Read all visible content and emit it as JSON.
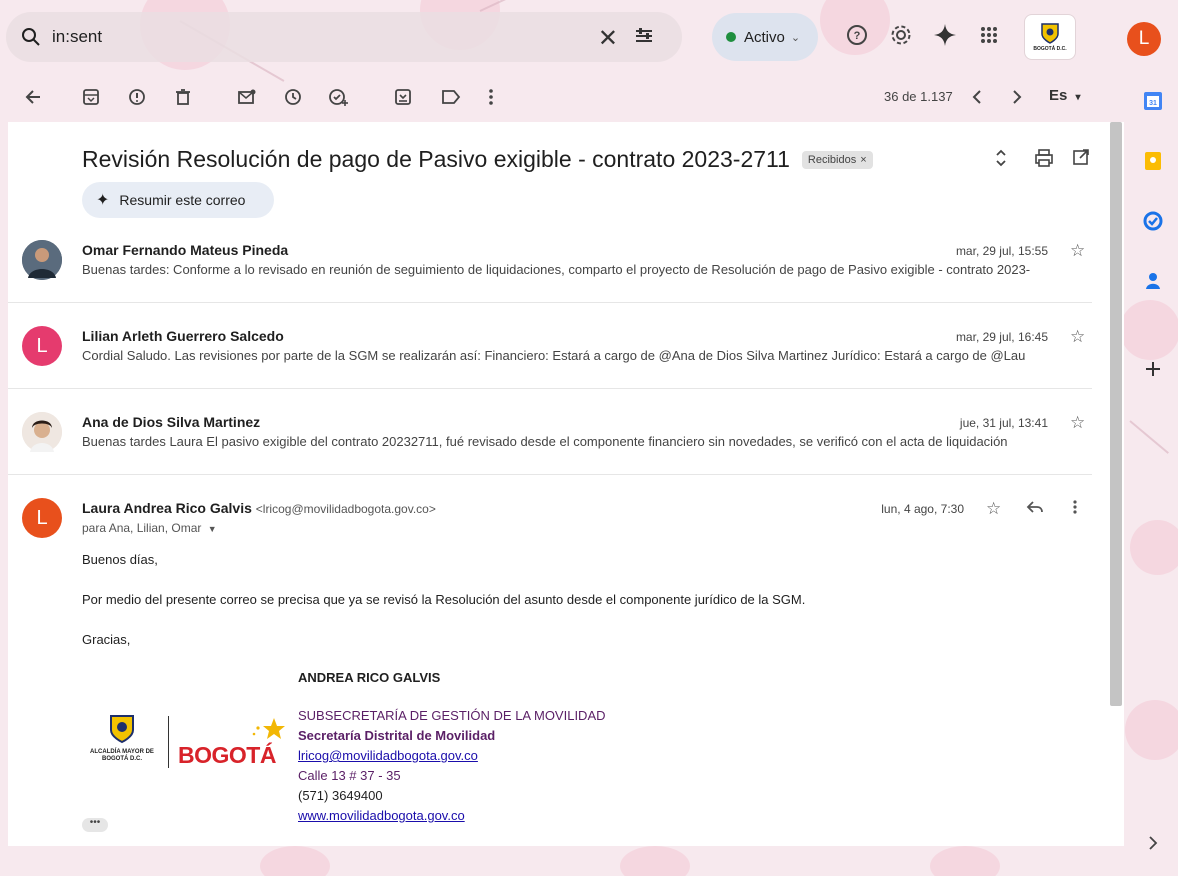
{
  "search": {
    "value": "in:sent"
  },
  "status": {
    "label": "Activo"
  },
  "org_logo": {
    "text": "BOGOTÁ D.C."
  },
  "user": {
    "initial": "L"
  },
  "toolbar": {
    "pager": "36 de 1.137",
    "lang": "Es"
  },
  "thread": {
    "subject": "Revisión Resolución de pago de Pasivo exigible - contrato 2023-2711",
    "label": "Recibidos",
    "label_close": "×",
    "summarize": "Resumir este correo"
  },
  "messages": [
    {
      "sender": "Omar Fernando Mateus Pineda",
      "date": "mar, 29 jul, 15:55",
      "snippet": "Buenas tardes: Conforme a lo revisado en reunión de seguimiento de liquidaciones, comparto el proyecto de Resolución de pago de Pasivo exigible - contrato 2023-",
      "avatar_color": "#3b4a5c"
    },
    {
      "sender": "Lilian Arleth Guerrero Salcedo",
      "date": "mar, 29 jul, 16:45",
      "snippet": "Cordial Saludo. Las revisiones por parte de la SGM se realizarán así: Financiero: Estará a cargo de @Ana de Dios Silva Martinez Jurídico: Estará a cargo de @Lau",
      "avatar_initial": "L",
      "avatar_color": "#e53b6e"
    },
    {
      "sender": "Ana de Dios Silva Martinez",
      "date": "jue, 31 jul, 13:41",
      "snippet": "Buenas tardes Laura El pasivo exigible del contrato 20232711, fué revisado desde el componente financiero sin novedades, se verificó con el acta de liquidación",
      "avatar_color": "#c9b6a8"
    }
  ],
  "expanded": {
    "sender": "Laura Andrea Rico Galvis",
    "email": "<lricog@movilidadbogota.gov.co>",
    "date": "lun, 4 ago, 7:30",
    "recipients": "para Ana, Lilian, Omar",
    "avatar_initial": "L",
    "avatar_color": "#e8501c",
    "greeting": "Buenos días,",
    "body": "Por medio del presente correo se precisa que ya se revisó la Resolución del asunto desde el componente jurídico de la SGM.",
    "closing": "Gracias,",
    "signature": {
      "name": "ANDREA RICO GALVIS",
      "dept": "SUBSECRETARÍA DE GESTIÓN DE LA MOVILIDAD",
      "org": "Secretaría Distrital de Movilidad",
      "email": "lricog@movilidadbogota.gov.co",
      "address": "Calle 13 # 37 - 35",
      "phone": "(571) 3649400",
      "web": "www.movilidadbogota.gov.co",
      "logo_left": "ALCALDÍA MAYOR DE BOGOTÁ D.C.",
      "logo_right": "BOGOTÁ"
    }
  },
  "more": "•••"
}
